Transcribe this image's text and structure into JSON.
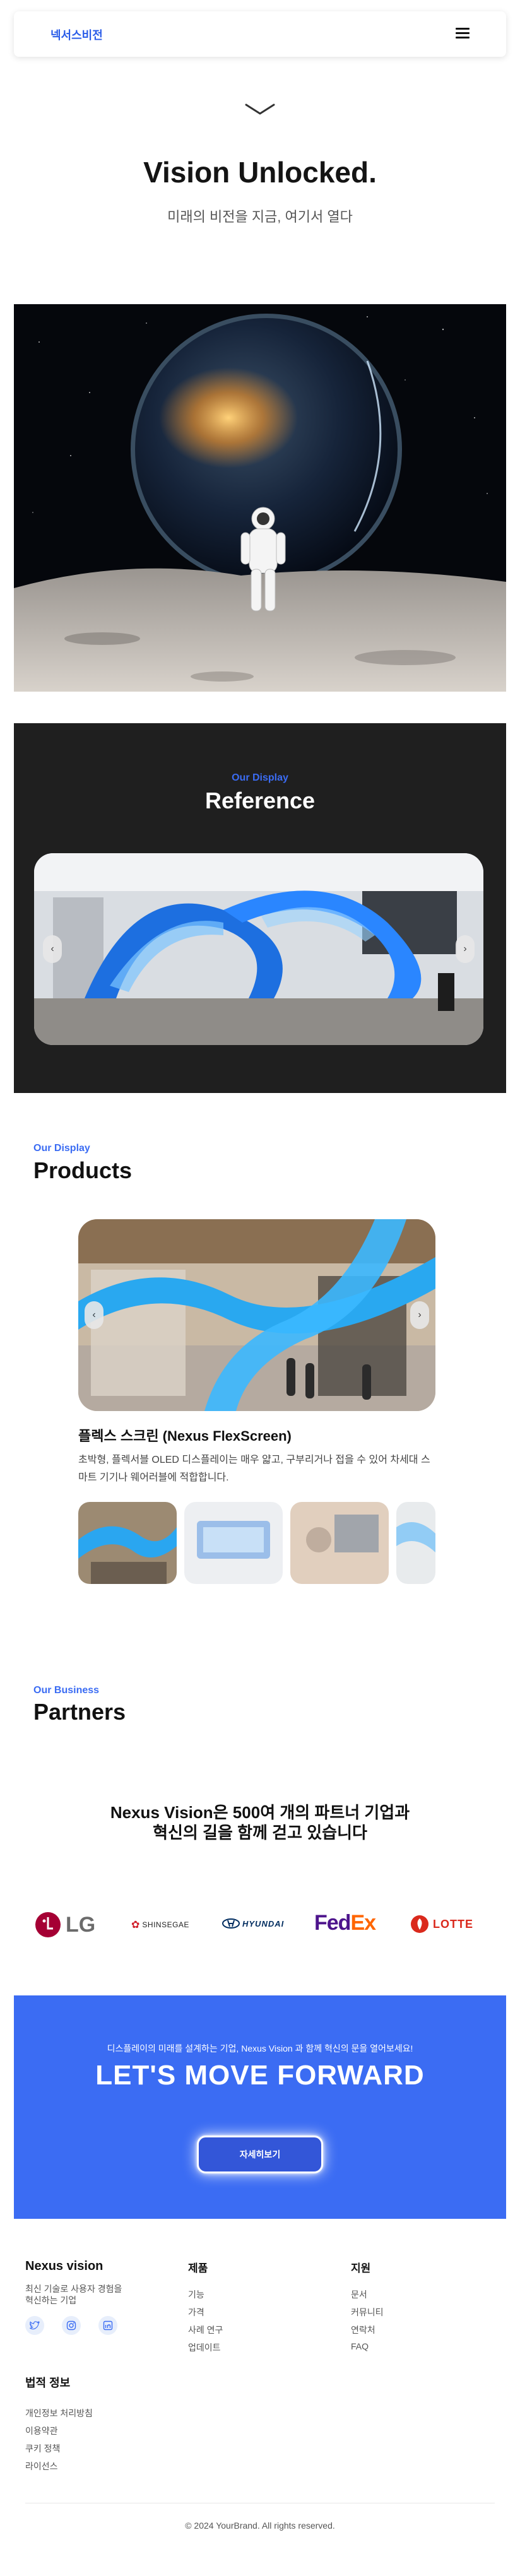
{
  "header": {
    "logo": "넥서스비전",
    "menu_icon": "hamburger-menu-icon"
  },
  "hero": {
    "scroll_icon": "chevron-down-icon",
    "title": "Vision Unlocked.",
    "subtitle": "미래의 비전을 지금, 여기서 열다"
  },
  "reference": {
    "eyebrow": "Our Display",
    "title": "Reference",
    "prev_icon": "chevron-left-icon",
    "next_icon": "chevron-right-icon",
    "prev_glyph": "‹",
    "next_glyph": "›"
  },
  "products": {
    "eyebrow": "Our Display",
    "title": "Products",
    "item_name": "플렉스 스크린 (Nexus FlexScreen)",
    "item_desc": "초박형, 플렉서블 OLED 디스플레이는 매우 얇고, 구부리거나 접을 수 있어 차세대 스마트 기기나 웨어러블에 적합합니다.",
    "prev_glyph": "‹",
    "next_glyph": "›"
  },
  "partners": {
    "eyebrow": "Our Business",
    "title": "Partners",
    "headline_line1": "Nexus Vision은 500여 개의 파트너 기업과",
    "headline_line2": "혁신의 길을 함께 걷고 있습니다",
    "logos": [
      "LG",
      "SHINSEGAE",
      "HYUNDAI",
      "FedEx",
      "LOTTE"
    ]
  },
  "cta": {
    "small": "디스플레이의 미래를 설계하는 기업, Nexus Vision 과 함께 혁신의 문을 열어보세요!",
    "big": "LET'S MOVE FORWARD",
    "button": "자세히보기"
  },
  "footer": {
    "brand": "Nexus vision",
    "tagline_line1": "최신 기술로 사용자 경험을",
    "tagline_line2": "혁신하는 기업",
    "social_icons": [
      "twitter-icon",
      "instagram-icon",
      "linkedin-icon"
    ],
    "col_product": {
      "title": "제품",
      "links": [
        "기능",
        "가격",
        "사례 연구",
        "업데이트"
      ]
    },
    "col_support": {
      "title": "지원",
      "links": [
        "문서",
        "커뮤니티",
        "연락처",
        "FAQ"
      ]
    },
    "legal": {
      "title": "법적 정보",
      "links": [
        "개인정보 처리방침",
        "이용약관",
        "쿠키 정책",
        "라이선스"
      ]
    },
    "copyright": "© 2024 YourBrand. All rights reserved."
  },
  "colors": {
    "accent": "#3b6cf3",
    "dark_section": "#1f1f1f",
    "text": "#1a1a1a",
    "lg": "#a50034",
    "fedex_purple": "#4d148c",
    "fedex_orange": "#ff6600",
    "lotte": "#da291c",
    "hyundai": "#002c5f"
  }
}
